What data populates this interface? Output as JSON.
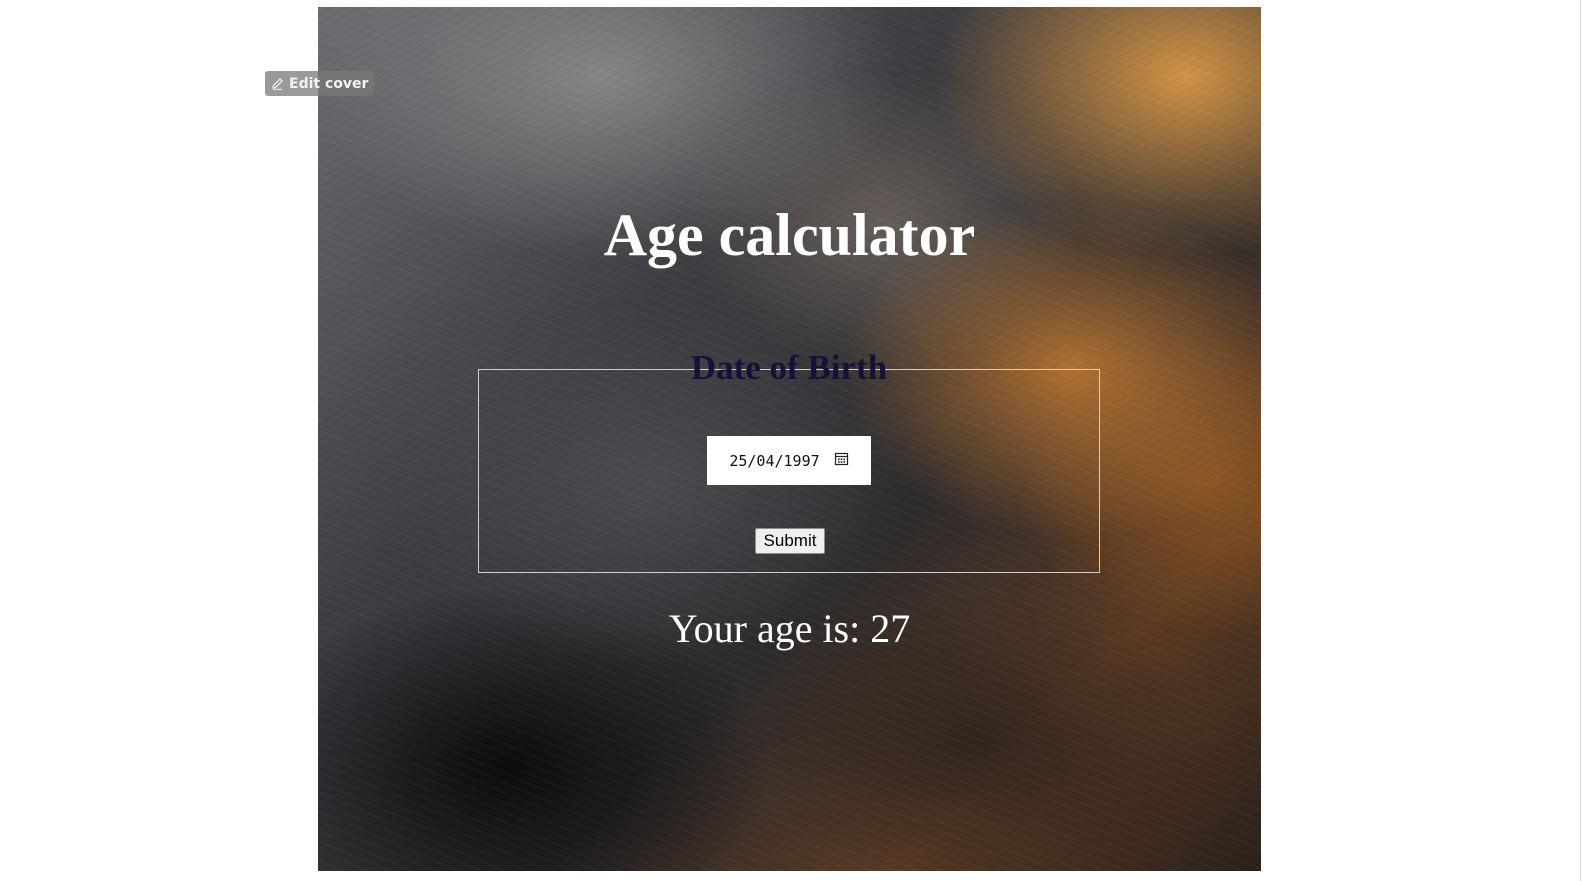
{
  "edit_cover": {
    "label": "Edit cover",
    "icon": "pencil-icon"
  },
  "title": "Age calculator",
  "form": {
    "legend": "Date of Birth",
    "date_value": "25/04/1997",
    "calendar_icon": "calendar-icon",
    "submit_label": "Submit"
  },
  "result": "Your age is: 27",
  "colors": {
    "title": "#ffffff",
    "legend": "#14123a",
    "fieldset_border": "#cfcfcf",
    "result": "#ffffff"
  }
}
